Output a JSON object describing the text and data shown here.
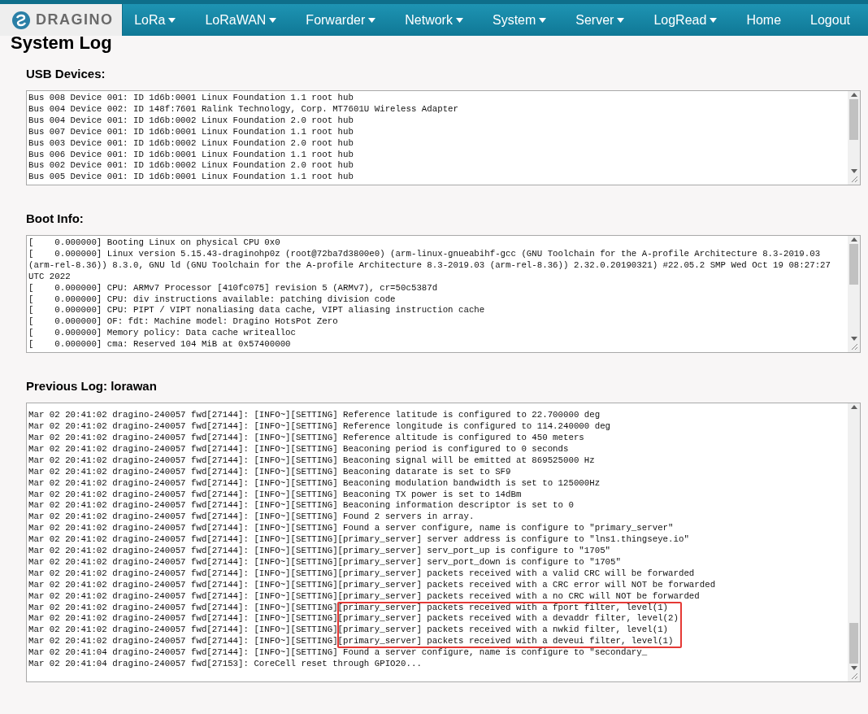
{
  "nav": {
    "logo": "DRAGINO",
    "items": [
      {
        "label": "LoRa",
        "dropdown": true
      },
      {
        "label": "LoRaWAN",
        "dropdown": true
      },
      {
        "label": "Forwarder",
        "dropdown": true
      },
      {
        "label": "Network",
        "dropdown": true
      },
      {
        "label": "System",
        "dropdown": true
      },
      {
        "label": "Server",
        "dropdown": true
      },
      {
        "label": "LogRead",
        "dropdown": true
      },
      {
        "label": "Home",
        "dropdown": false
      },
      {
        "label": "Logout",
        "dropdown": false
      }
    ]
  },
  "page_title": "System Log",
  "sections": [
    {
      "heading": "USB Devices:",
      "lines": [
        {
          "text": "Bus 008 Device 001: ID 1d6b:0001 Linux Foundation 1.1 root hub"
        },
        {
          "text": "Bus 004 Device 002: ID 148f:7601 Ralink Technology, Corp. MT7601U Wireless Adapter"
        },
        {
          "text": "Bus 004 Device 001: ID 1d6b:0002 Linux Foundation 2.0 root hub"
        },
        {
          "text": "Bus 007 Device 001: ID 1d6b:0001 Linux Foundation 1.1 root hub"
        },
        {
          "text": "Bus 003 Device 001: ID 1d6b:0002 Linux Foundation 2.0 root hub"
        },
        {
          "text": "Bus 006 Device 001: ID 1d6b:0001 Linux Foundation 1.1 root hub"
        },
        {
          "text": "Bus 002 Device 001: ID 1d6b:0002 Linux Foundation 2.0 root hub"
        },
        {
          "text": "Bus 005 Device 001: ID 1d6b:0001 Linux Foundation 1.1 root hub"
        }
      ]
    },
    {
      "heading": "Boot Info:",
      "lines": [
        {
          "text": "[    0.000000] Booting Linux on physical CPU 0x0"
        },
        {
          "text": "[    0.000000] Linux version 5.15.43-draginohp0z (root@72ba7d3800e0) (arm-linux-gnueabihf-gcc (GNU Toolchain for the A-profile Architecture 8.3-2019.03 (arm-rel-8.36)) 8.3.0, GNU ld (GNU Toolchain for the A-profile Architecture 8.3-2019.03 (arm-rel-8.36)) 2.32.0.20190321) #22.05.2 SMP Wed Oct 19 08:27:27 UTC 2022"
        },
        {
          "text": "[    0.000000] CPU: ARMv7 Processor [410fc075] revision 5 (ARMv7), cr=50c5387d"
        },
        {
          "text": "[    0.000000] CPU: div instructions available: patching division code"
        },
        {
          "text": "[    0.000000] CPU: PIPT / VIPT nonaliasing data cache, VIPT aliasing instruction cache"
        },
        {
          "text": "[    0.000000] OF: fdt: Machine model: Dragino HotsPot Zero"
        },
        {
          "text": "[    0.000000] Memory policy: Data cache writealloc"
        },
        {
          "text": "[    0.000000] cma: Reserved 104 MiB at 0x57400000"
        }
      ]
    },
    {
      "heading": "Previous Log: lorawan",
      "lines": [
        {
          "text": "Mar 02 20:41:02 dragino-240057 fwd[27144]: [INFO~][SETTING] Reference latitude is configured to 22.700000 deg",
          "highlighted": false
        },
        {
          "text": "Mar 02 20:41:02 dragino-240057 fwd[27144]: [INFO~][SETTING] Reference longitude is configured to 114.240000 deg",
          "highlighted": false
        },
        {
          "text": "Mar 02 20:41:02 dragino-240057 fwd[27144]: [INFO~][SETTING] Reference altitude is configured to 450 meters",
          "highlighted": false
        },
        {
          "text": "Mar 02 20:41:02 dragino-240057 fwd[27144]: [INFO~][SETTING] Beaconing period is configured to 0 seconds",
          "highlighted": false
        },
        {
          "text": "Mar 02 20:41:02 dragino-240057 fwd[27144]: [INFO~][SETTING] Beaconing signal will be emitted at 869525000 Hz",
          "highlighted": false
        },
        {
          "text": "Mar 02 20:41:02 dragino-240057 fwd[27144]: [INFO~][SETTING] Beaconing datarate is set to SF9",
          "highlighted": false
        },
        {
          "text": "Mar 02 20:41:02 dragino-240057 fwd[27144]: [INFO~][SETTING] Beaconing modulation bandwidth is set to 125000Hz",
          "highlighted": false
        },
        {
          "text": "Mar 02 20:41:02 dragino-240057 fwd[27144]: [INFO~][SETTING] Beaconing TX power is set to 14dBm",
          "highlighted": false
        },
        {
          "text": "Mar 02 20:41:02 dragino-240057 fwd[27144]: [INFO~][SETTING] Beaconing information descriptor is set to 0",
          "highlighted": false
        },
        {
          "text": "Mar 02 20:41:02 dragino-240057 fwd[27144]: [INFO~][SETTING] Found 2 servers in array.",
          "highlighted": false
        },
        {
          "text": "Mar 02 20:41:02 dragino-240057 fwd[27144]: [INFO~][SETTING] Found a server configure, name is configure to \"primary_server\"",
          "highlighted": false
        },
        {
          "text": "Mar 02 20:41:02 dragino-240057 fwd[27144]: [INFO~][SETTING][primary_server] server address is configure to \"lns1.thingseye.io\"",
          "highlighted": false
        },
        {
          "text": "Mar 02 20:41:02 dragino-240057 fwd[27144]: [INFO~][SETTING][primary_server] serv_port_up is configure to \"1705\"",
          "highlighted": false
        },
        {
          "text": "Mar 02 20:41:02 dragino-240057 fwd[27144]: [INFO~][SETTING][primary_server] serv_port_down is configure to \"1705\"",
          "highlighted": false
        },
        {
          "text": "Mar 02 20:41:02 dragino-240057 fwd[27144]: [INFO~][SETTING][primary_server] packets received with a valid CRC will be forwarded",
          "highlighted": false
        },
        {
          "text": "Mar 02 20:41:02 dragino-240057 fwd[27144]: [INFO~][SETTING][primary_server] packets received with a CRC error will NOT be forwarded",
          "highlighted": false
        },
        {
          "text": "Mar 02 20:41:02 dragino-240057 fwd[27144]: [INFO~][SETTING][primary_server] packets received with a no CRC will NOT be forwarded",
          "highlighted": false
        },
        {
          "text": "Mar 02 20:41:02 dragino-240057 fwd[27144]: [INFO~][SETTING][primary_server] packets received with a fport filter, level(1)",
          "highlighted": true
        },
        {
          "text": "Mar 02 20:41:02 dragino-240057 fwd[27144]: [INFO~][SETTING][primary_server] packets received with a devaddr filter, level(2)",
          "highlighted": true
        },
        {
          "text": "Mar 02 20:41:02 dragino-240057 fwd[27144]: [INFO~][SETTING][primary_server] packets received with a nwkid filter, level(1)",
          "highlighted": true
        },
        {
          "text": "Mar 02 20:41:02 dragino-240057 fwd[27144]: [INFO~][SETTING][primary_server] packets received with a deveui filter, level(1)",
          "highlighted": true
        },
        {
          "text": "Mar 02 20:41:04 dragino-240057 fwd[27144]: [INFO~][SETTING] Found a server configure, name is configure to \"secondary_",
          "highlighted": false
        },
        {
          "text": "Mar 02 20:41:04 dragino-240057 fwd[27153]: CoreCell reset through GPIO20...",
          "highlighted": false
        }
      ]
    }
  ]
}
